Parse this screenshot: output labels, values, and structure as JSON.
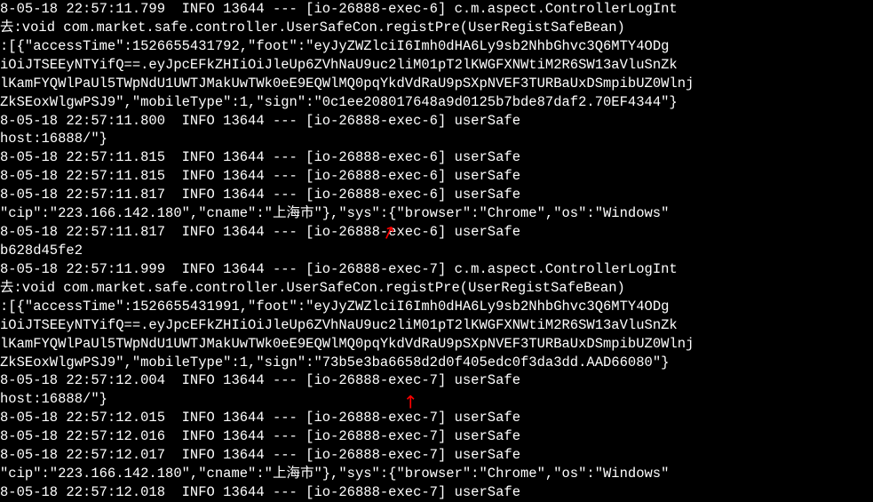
{
  "lines": [
    "8-05-18 22:57:11.799  INFO 13644 --- [io-26888-exec-6] c.m.aspect.ControllerLogInt",
    "去:void com.market.safe.controller.UserSafeCon.registPre(UserRegistSafeBean)",
    ":[{\"accessTime\":1526655431792,\"foot\":\"eyJyZWZlciI6Imh0dHA6Ly9sb2NhbGhvc3Q6MTY4ODg",
    "iOiJTSEEyNTYifQ==.eyJpcEFkZHIiOiJleUp6ZVhNaU9uc2liM01pT2lKWGFXNWtiM2R6SW13aVluSnZk",
    "lKamFYQWlPaUl5TWpNdU1UWTJMakUwTWk0eE9EQWlMQ0pqYkdVdRaU9pSXpNVEF3TURBaUxDSmpibUZ0Wlnj",
    "ZkSEoxWlgwPSJ9\",\"mobileType\":1,\"sign\":\"0c1ee208017648a9d0125b7bde87daf2.70EF4344\"}",
    "8-05-18 22:57:11.800  INFO 13644 --- [io-26888-exec-6] userSafe",
    "host:16888/\"}",
    "8-05-18 22:57:11.815  INFO 13644 --- [io-26888-exec-6] userSafe",
    "8-05-18 22:57:11.815  INFO 13644 --- [io-26888-exec-6] userSafe",
    "8-05-18 22:57:11.817  INFO 13644 --- [io-26888-exec-6] userSafe",
    "\"cip\":\"223.166.142.180\",\"cname\":\"上海市\"},\"sys\":{\"browser\":\"Chrome\",\"os\":\"Windows\"",
    "8-05-18 22:57:11.817  INFO 13644 --- [io-26888-exec-6] userSafe",
    "b628d45fe2",
    "8-05-18 22:57:11.999  INFO 13644 --- [io-26888-exec-7] c.m.aspect.ControllerLogInt",
    "去:void com.market.safe.controller.UserSafeCon.registPre(UserRegistSafeBean)",
    ":[{\"accessTime\":1526655431991,\"foot\":\"eyJyZWZlciI6Imh0dHA6Ly9sb2NhbGhvc3Q6MTY4ODg",
    "iOiJTSEEyNTYifQ==.eyJpcEFkZHIiOiJleUp6ZVhNaU9uc2liM01pT2lKWGFXNWtiM2R6SW13aVluSnZk",
    "lKamFYQWlPaUl5TWpNdU1UWTJMakUwTWk0eE9EQWlMQ0pqYkdVdRaU9pSXpNVEF3TURBaUxDSmpibUZ0Wlnj",
    "ZkSEoxWlgwPSJ9\",\"mobileType\":1,\"sign\":\"73b5e3ba6658d2d0f405edc0f3da3dd.AAD66080\"}",
    "8-05-18 22:57:12.004  INFO 13644 --- [io-26888-exec-7] userSafe",
    "host:16888/\"}",
    "8-05-18 22:57:12.015  INFO 13644 --- [io-26888-exec-7] userSafe",
    "8-05-18 22:57:12.016  INFO 13644 --- [io-26888-exec-7] userSafe",
    "8-05-18 22:57:12.017  INFO 13644 --- [io-26888-exec-7] userSafe",
    "\"cip\":\"223.166.142.180\",\"cname\":\"上海市\"},\"sys\":{\"browser\":\"Chrome\",\"os\":\"Windows\"",
    "8-05-18 22:57:12.018  INFO 13644 --- [io-26888-exec-7] userSafe"
  ],
  "annotations": {
    "arrow1": "↗",
    "arrow2": "↗"
  }
}
